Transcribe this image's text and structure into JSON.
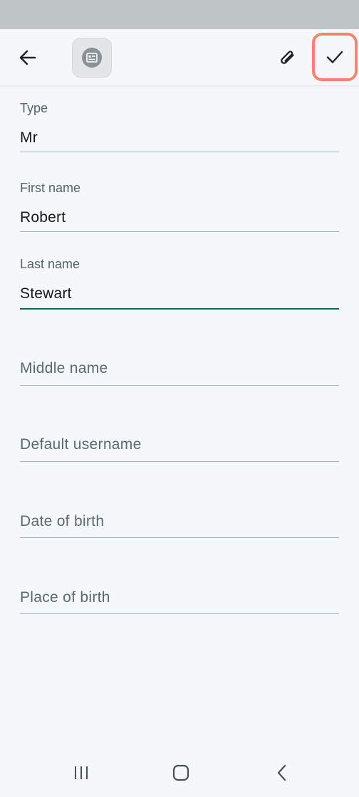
{
  "header": {
    "icons": {
      "back": "arrow-left-icon",
      "record": "contact-card-icon",
      "attach": "paperclip-icon",
      "save": "checkmark-icon"
    },
    "accent_color": "#f4846a",
    "focus_color": "#1d5f68"
  },
  "form": {
    "type": {
      "label": "Type",
      "value": "Mr"
    },
    "first_name": {
      "label": "First name",
      "value": "Robert"
    },
    "last_name": {
      "label": "Last name",
      "value": "Stewart"
    },
    "middle_name": {
      "placeholder": "Middle name"
    },
    "default_username": {
      "placeholder": "Default username"
    },
    "date_of_birth": {
      "placeholder": "Date of birth"
    },
    "place_of_birth": {
      "placeholder": "Place of birth"
    }
  },
  "nav": {
    "icons": {
      "recents": "recent-apps-icon",
      "home": "home-icon",
      "back": "nav-back-icon"
    }
  }
}
